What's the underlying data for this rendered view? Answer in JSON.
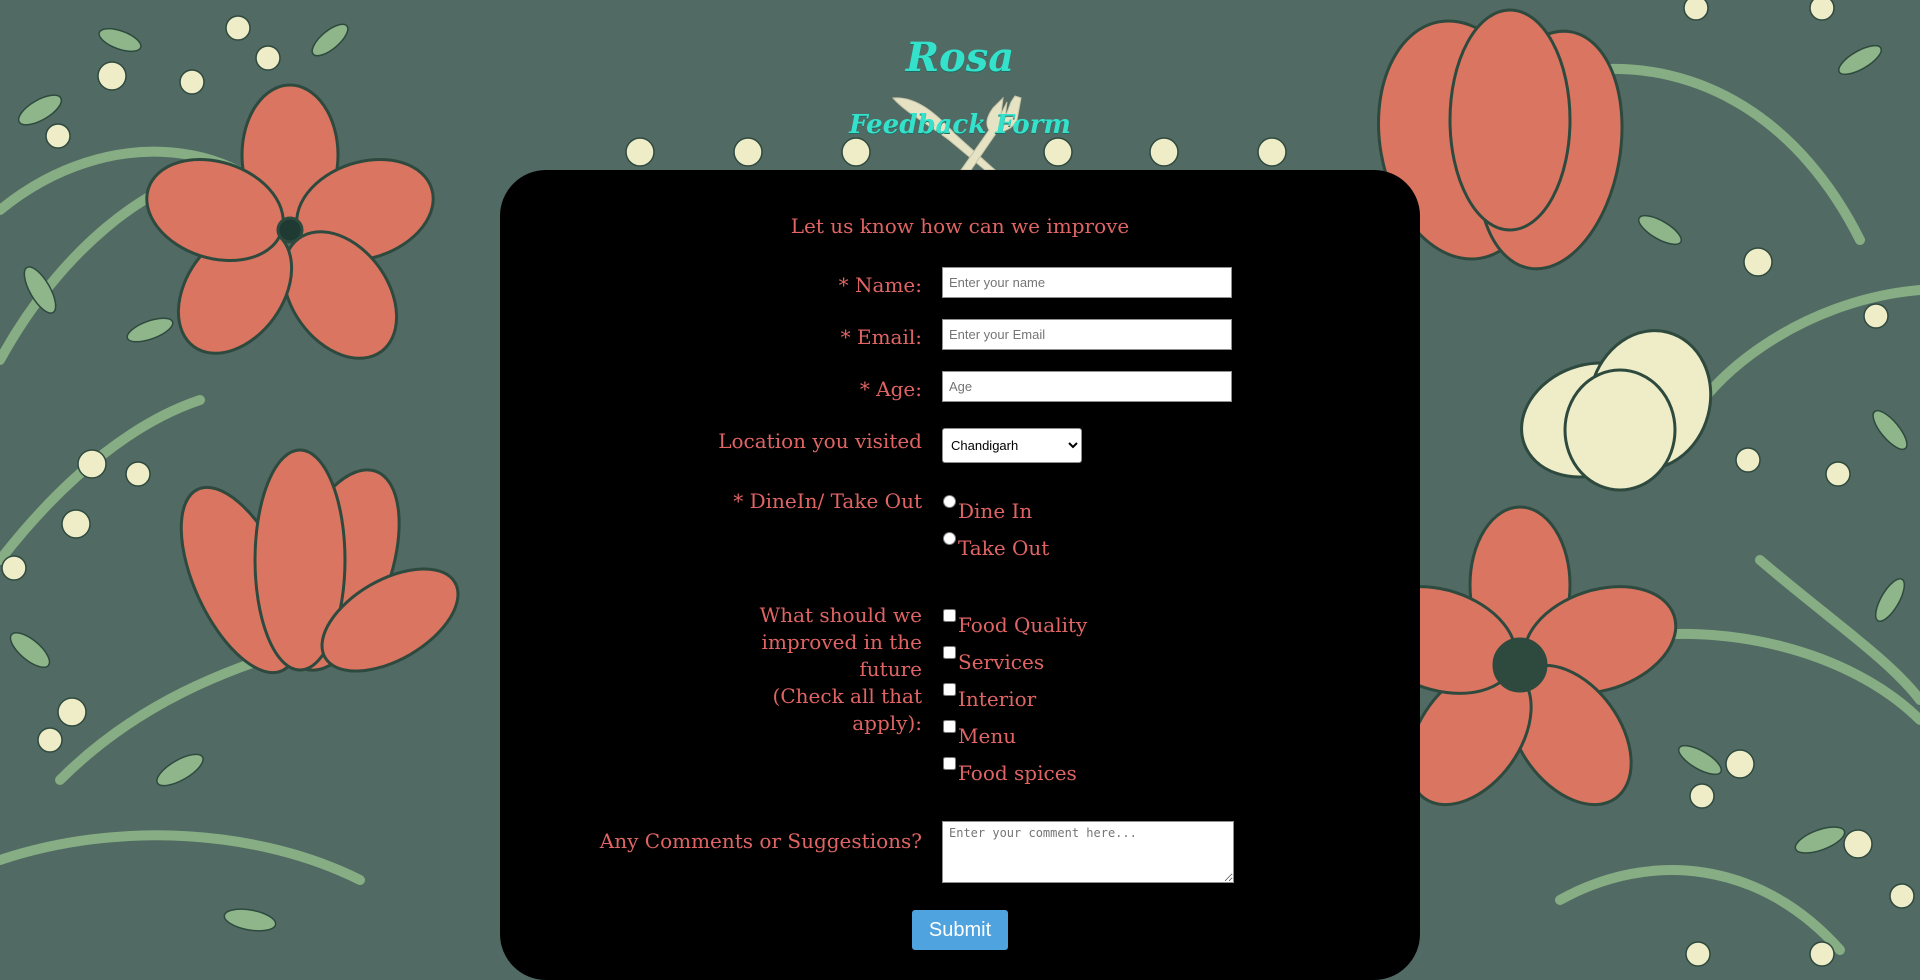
{
  "header": {
    "brand_name": "Rosa",
    "subtitle": "Feedback Form",
    "utensils_icon": "fork-knife-icon"
  },
  "form": {
    "intro": "Let us know how can we improve",
    "name": {
      "label": "* Name:",
      "placeholder": "Enter your name",
      "value": ""
    },
    "email": {
      "label": "* Email:",
      "placeholder": "Enter your Email",
      "value": ""
    },
    "age": {
      "label": "* Age:",
      "placeholder": "Age",
      "value": ""
    },
    "location": {
      "label": "Location you visited",
      "selected": "Chandigarh"
    },
    "dine": {
      "label": "* DineIn/ Take Out",
      "options": [
        "Dine In",
        "Take Out"
      ]
    },
    "improve": {
      "label_lines": [
        "What should we",
        "improved in the",
        "future",
        "(Check all that",
        "apply):"
      ],
      "options": [
        "Food Quality",
        "Services",
        "Interior",
        "Menu",
        "Food spices"
      ]
    },
    "comments": {
      "label": "Any Comments or Suggestions?",
      "placeholder": "Enter your comment here..."
    },
    "submit_label": "Submit"
  },
  "colors": {
    "background": "#516a63",
    "brand": "#34e2cc",
    "label_text": "#e06464",
    "card": "#000000",
    "submit": "#4fa3df",
    "flower_red": "#d97560",
    "flower_cream": "#efedc8",
    "leaf": "#8fb58a"
  }
}
